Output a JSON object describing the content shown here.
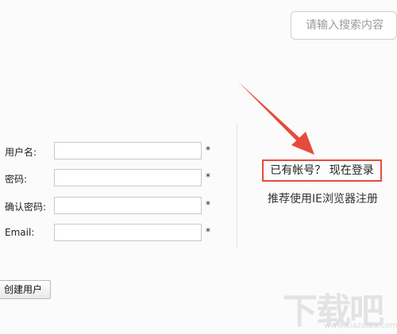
{
  "search": {
    "placeholder": "请输入搜索内容"
  },
  "form": {
    "fields": [
      {
        "label": "用户名:",
        "value": "",
        "required_mark": "*"
      },
      {
        "label": "密码:",
        "value": "",
        "required_mark": "*"
      },
      {
        "label": "确认密码:",
        "value": "",
        "required_mark": "*"
      },
      {
        "label": "Email:",
        "value": "",
        "required_mark": "*"
      }
    ],
    "submit_label": "创建用户"
  },
  "side": {
    "login_link": "已有帐号？ 现在登录",
    "browser_hint": "推荐使用IE浏览器注册"
  },
  "annotation": {
    "arrow_color": "#e64b3c"
  },
  "watermark": {
    "main": "下载吧",
    "sub": "www.xiazaiba.com"
  }
}
